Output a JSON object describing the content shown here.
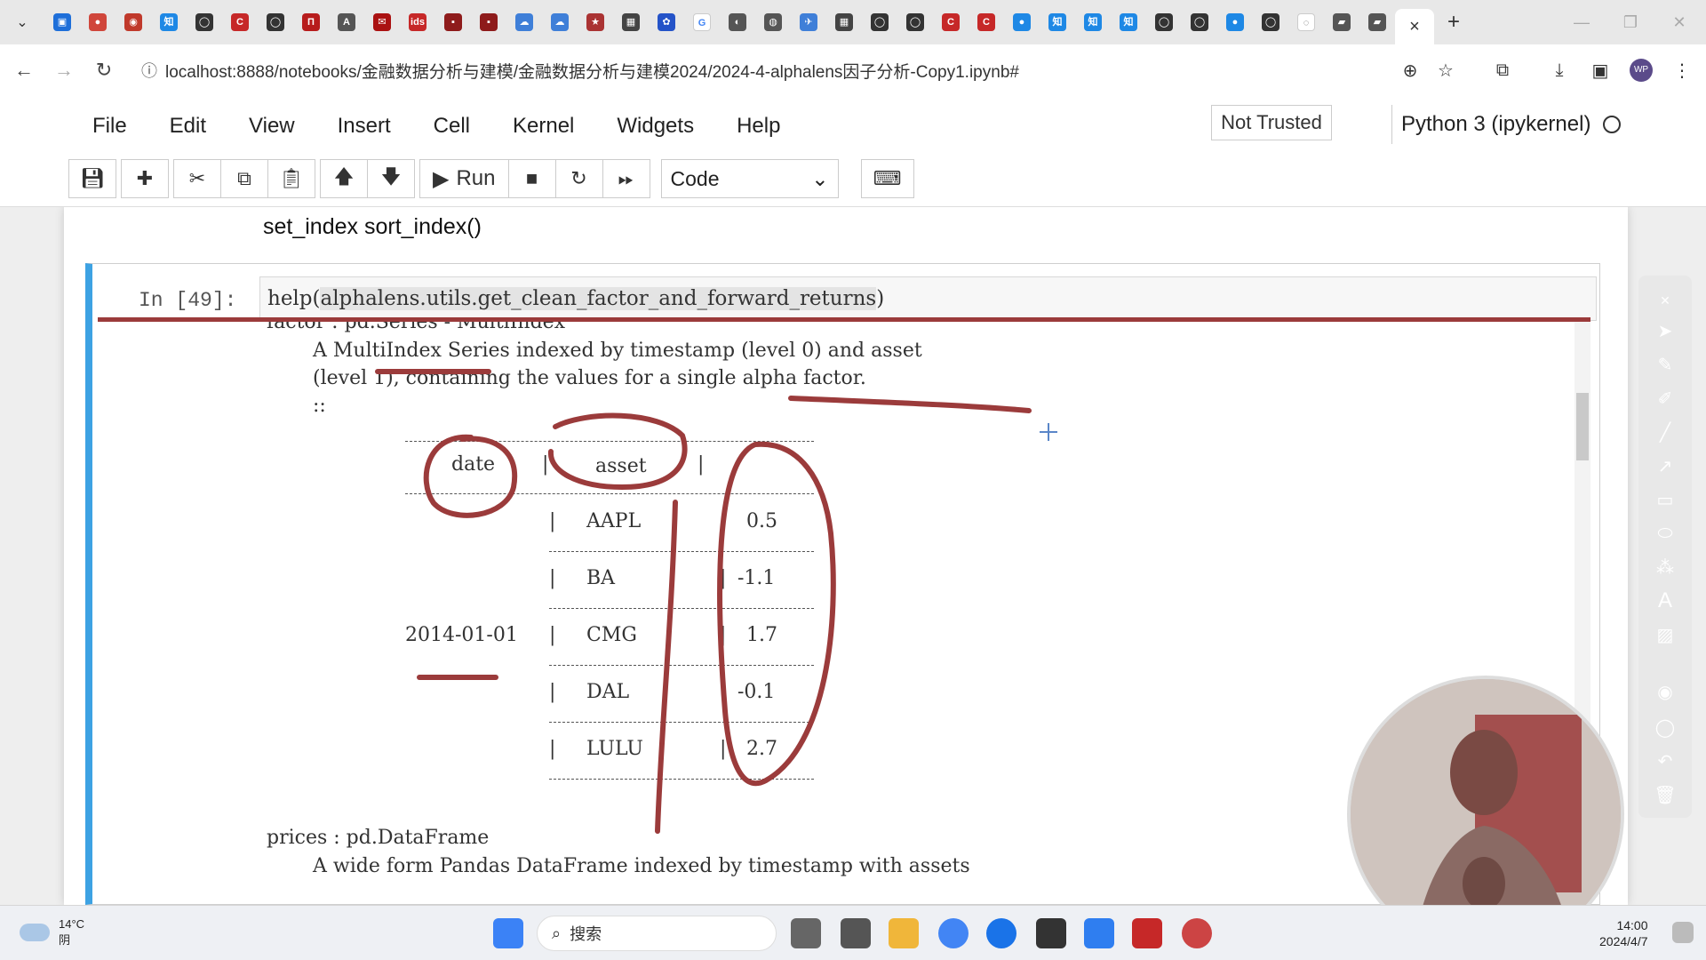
{
  "browser": {
    "tab_menu_icon": "chevron-down-icon",
    "active_tab_close": "×",
    "new_tab": "+",
    "window_controls": [
      "—",
      "❐",
      "✕"
    ],
    "url": "localhost:8888/notebooks/金融数据分析与建模/金融数据分析与建模2024/2024-4-alphalens因子分析-Copy1.ipynb#",
    "profile_initials": "WP"
  },
  "jupyter": {
    "menu": [
      "File",
      "Edit",
      "View",
      "Insert",
      "Cell",
      "Kernel",
      "Widgets",
      "Help"
    ],
    "trusted": "Not Trusted",
    "kernel": "Python 3 (ipykernel)",
    "toolbar": {
      "run_label": "Run",
      "cell_type": "Code"
    }
  },
  "notebook": {
    "markdown_line": "set_index sort_index()",
    "cell": {
      "prompt": "In  [49]:",
      "code_prefix": "help(",
      "code_arg": "alphalens.utils.get_clean_factor_and_forward_returns",
      "code_suffix": ")"
    },
    "output": {
      "line_factor": "factor : pd.Series - MultiIndex",
      "line1a": "A ",
      "line1b": "MultiIndex",
      "line1c": " Series indexed by timestamp (level 0) and asset",
      "line2": "(level 1), containing the values for a single alpha factor.",
      "line3": "::",
      "table": {
        "headers": [
          "date",
          "asset"
        ],
        "date_value": "2014-01-01",
        "rows": [
          {
            "asset": "AAPL",
            "value": "0.5"
          },
          {
            "asset": "BA",
            "value": "-1.1"
          },
          {
            "asset": "CMG",
            "value": "1.7"
          },
          {
            "asset": "DAL",
            "value": "-0.1"
          },
          {
            "asset": "LULU",
            "value": "2.7"
          }
        ]
      },
      "line_prices": "prices : pd.DataFrame",
      "line_prices_desc": "A wide form Pandas DataFrame indexed by timestamp with assets"
    }
  },
  "annotation_color": "#9b3b3b",
  "accent_color": "#3da2e3",
  "taskbar": {
    "temperature": "14°C",
    "weather_desc": "阴",
    "search_placeholder": "搜索",
    "time": "14:00",
    "date": "2024/4/7"
  }
}
